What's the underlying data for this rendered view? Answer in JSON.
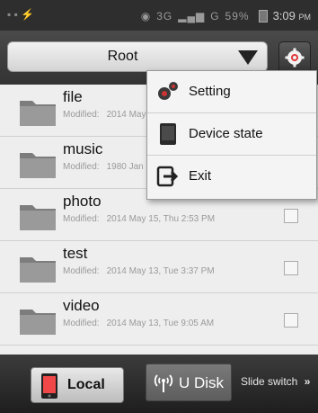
{
  "status_bar": {
    "network": "3G",
    "signal_2": "G",
    "battery": "59%",
    "time": "3:09",
    "ampm": "PM"
  },
  "header": {
    "path_label": "Root"
  },
  "files": [
    {
      "name": "file",
      "modified_label": "Modified:",
      "modified": "2014 May"
    },
    {
      "name": "music",
      "modified_label": "Modified:",
      "modified": "1980 Jan"
    },
    {
      "name": "photo",
      "modified_label": "Modified:",
      "modified": "2014 May 15, Thu 2:53 PM"
    },
    {
      "name": "test",
      "modified_label": "Modified:",
      "modified": "2014 May 13, Tue 3:37 PM"
    },
    {
      "name": "video",
      "modified_label": "Modified:",
      "modified": "2014 May 13, Tue 9:05 AM"
    }
  ],
  "menu": {
    "items": [
      {
        "label": "Setting",
        "icon": "gears-icon"
      },
      {
        "label": "Device state",
        "icon": "device-icon"
      },
      {
        "label": "Exit",
        "icon": "exit-icon"
      }
    ]
  },
  "bottom": {
    "local_label": "Local",
    "udisk_label": "U Disk",
    "slide_switch_label": "Slide switch"
  }
}
